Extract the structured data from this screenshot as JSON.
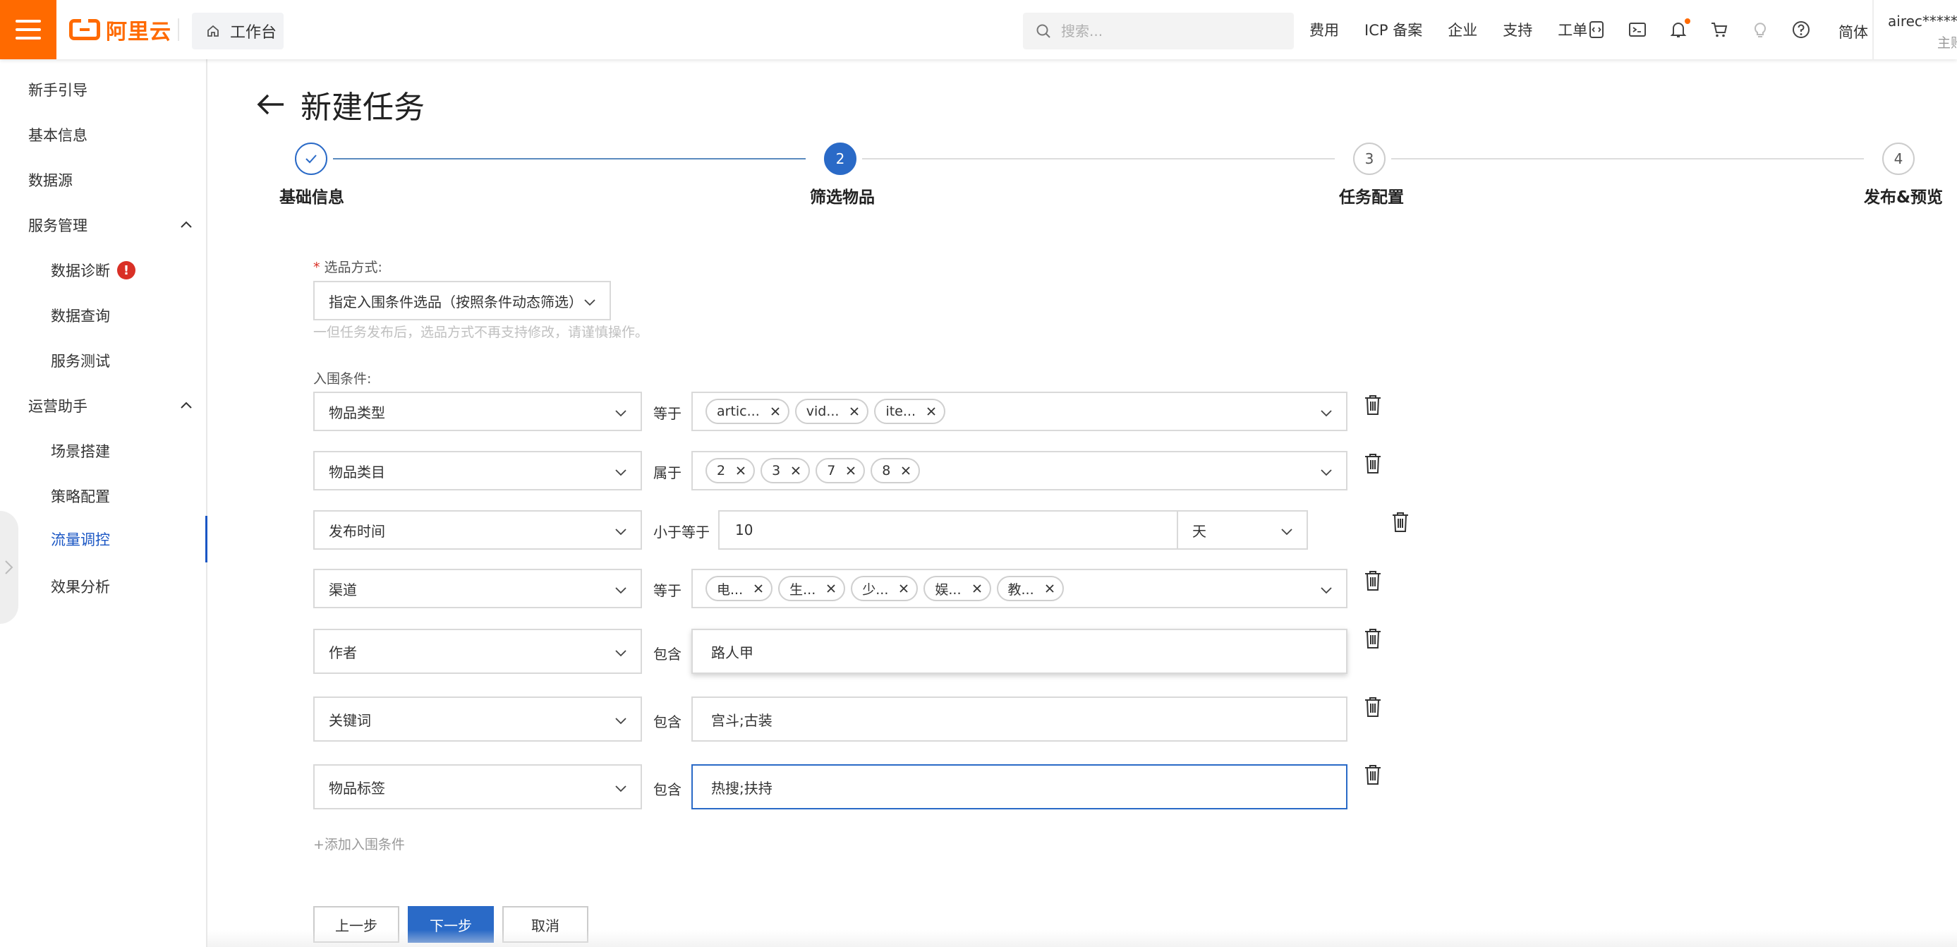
{
  "header": {
    "brand": "阿里云",
    "workbench": "工作台",
    "search_placeholder": "搜索...",
    "links": [
      "费用",
      "ICP 备案",
      "企业",
      "支持",
      "工单"
    ],
    "language": "简体",
    "user_name": "airec*****@",
    "user_role": "主账",
    "accent": "#ff6a00"
  },
  "sidebar": {
    "items": [
      {
        "label": "新手引导"
      },
      {
        "label": "基本信息"
      },
      {
        "label": "数据源"
      },
      {
        "label": "服务管理"
      },
      {
        "label": "数据诊断",
        "badge": "!"
      },
      {
        "label": "数据查询"
      },
      {
        "label": "服务测试"
      },
      {
        "label": "运营助手"
      },
      {
        "label": "场景搭建"
      },
      {
        "label": "策略配置"
      },
      {
        "label": "流量调控"
      },
      {
        "label": "效果分析"
      }
    ],
    "active_color": "#1a56c4"
  },
  "page": {
    "title": "新建任务"
  },
  "steps": [
    {
      "number": "",
      "label": "基础信息",
      "state": "done"
    },
    {
      "number": "2",
      "label": "筛选物品",
      "state": "current"
    },
    {
      "number": "3",
      "label": "任务配置",
      "state": "pending"
    },
    {
      "number": "4",
      "label": "发布&预览",
      "state": "pending"
    }
  ],
  "form": {
    "selection_label": "选品方式:",
    "selection_required_mark": "*",
    "selection_value": "指定入围条件选品（按照条件动态筛选）",
    "selection_hint": "一但任务发布后，选品方式不再支持修改，请谨慎操作。",
    "conditions_label": "入围条件:",
    "conditions": [
      {
        "field": "物品类型",
        "operator": "等于",
        "tags": [
          "artic...",
          "vid...",
          "ite..."
        ]
      },
      {
        "field": "物品类目",
        "operator": "属于",
        "tags": [
          "2",
          "3",
          "7",
          "8"
        ]
      },
      {
        "field": "发布时间",
        "operator": "小于等于",
        "value": "10",
        "unit": "天"
      },
      {
        "field": "渠道",
        "operator": "等于",
        "tags": [
          "电...",
          "生...",
          "少...",
          "娱...",
          "教..."
        ]
      },
      {
        "field": "作者",
        "operator": "包含",
        "value": "路人甲"
      },
      {
        "field": "关键词",
        "operator": "包含",
        "value": "宫斗;古装"
      },
      {
        "field": "物品标签",
        "operator": "包含",
        "value": "热搜;扶持"
      }
    ],
    "add_condition": "+添加入围条件"
  },
  "buttons": {
    "prev": "上一步",
    "next": "下一步",
    "cancel": "取消",
    "primary_color": "#2a6ac7"
  }
}
